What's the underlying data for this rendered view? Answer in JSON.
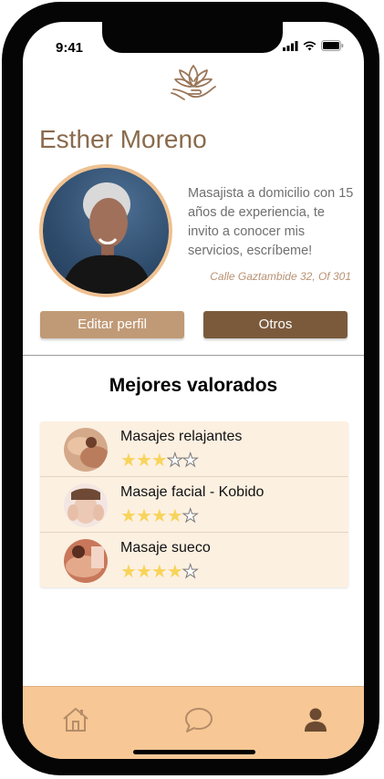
{
  "status_bar": {
    "time": "9:41"
  },
  "profile": {
    "name": "Esther Moreno",
    "bio": "Masajista a domicilio con 15 años de experiencia, te invito a conocer mis servicios, escríbeme!",
    "address": "Calle Gaztambide 32, Of 301"
  },
  "actions": {
    "edit_label": "Editar perfil",
    "other_label": "Otros"
  },
  "top_rated": {
    "title": "Mejores valorados",
    "items": [
      {
        "name": "Masajes relajantes",
        "rating": 3,
        "max": 5
      },
      {
        "name": "Masaje facial - Kobido",
        "rating": 4,
        "max": 5
      },
      {
        "name": "Masaje sueco",
        "rating": 4,
        "max": 5
      }
    ]
  },
  "tabbar": {
    "items": [
      "home-icon",
      "chat-icon",
      "profile-icon"
    ]
  },
  "colors": {
    "accent": "#c09a76",
    "accent_dark": "#7b5a3c",
    "tabbar": "#f7c795",
    "star": "#f7d45b",
    "list_bg": "#fcf0e1",
    "name": "#8a6a4c"
  }
}
